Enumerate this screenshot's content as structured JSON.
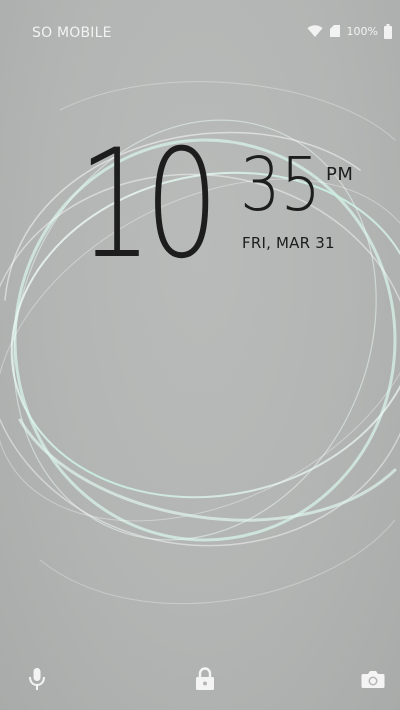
{
  "status_bar": {
    "carrier": "SO MOBILE",
    "icons": [
      "wifi-icon",
      "signal-icon",
      "battery-icon"
    ],
    "battery_percent": "100%"
  },
  "clock": {
    "hours": "10",
    "minutes": "35",
    "ampm": "PM",
    "date": "FRI, MAR 31"
  },
  "bottom_bar": {
    "icons": [
      "microphone-icon",
      "lock-icon",
      "camera-icon"
    ]
  },
  "colors": {
    "background": "#b4b6b5",
    "text": "#1d1d1d",
    "status_text": "#f2f2f2",
    "swirl_accent": "#c8efe2"
  }
}
